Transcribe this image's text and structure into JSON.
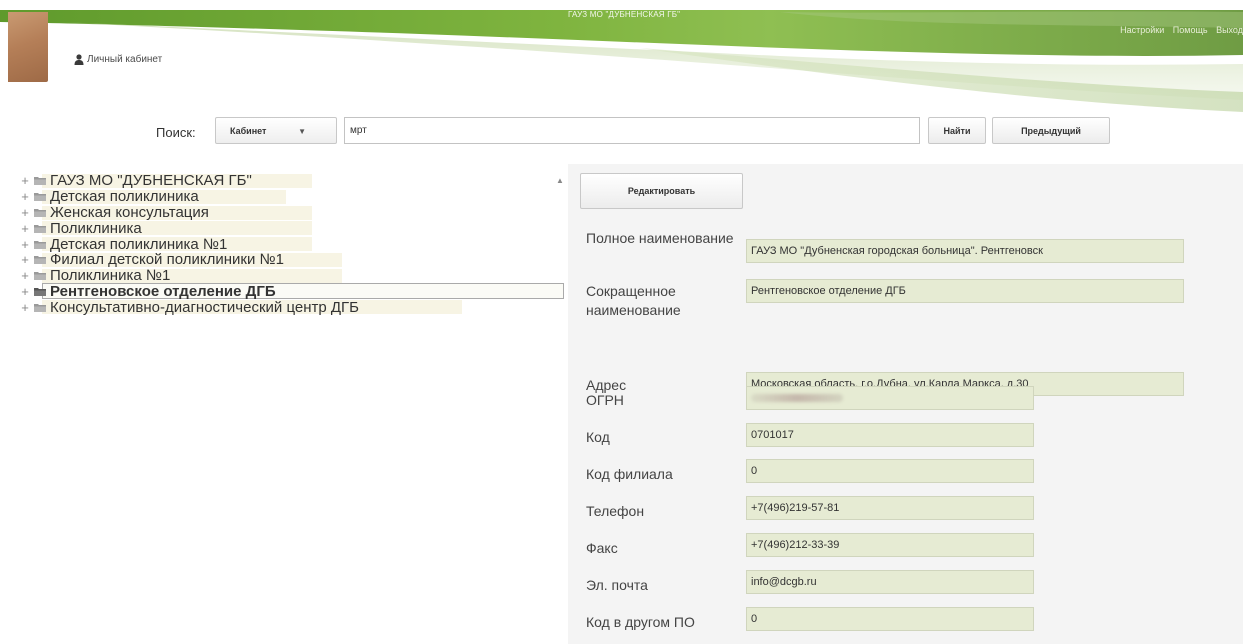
{
  "header": {
    "org_title": "ГАУЗ МО \"ДУБНЕНСКАЯ ГБ\"",
    "links": [
      "Настройки",
      "Помощь",
      "Выход"
    ],
    "cabinet_label": "Личный кабинет",
    "brand_green": "#7aab3c"
  },
  "search": {
    "label": "Поиск:",
    "type_value": "Кабинет",
    "query": "мрт",
    "find_label": "Найти",
    "prev_label": "Предыдущий"
  },
  "tree": {
    "items": [
      {
        "label": "ГАУЗ МО \"ДУБНЕНСКАЯ ГБ\"",
        "selected": false
      },
      {
        "label": "Детская поликлиника",
        "selected": false
      },
      {
        "label": "Женская консультация",
        "selected": false
      },
      {
        "label": "Поликлиника",
        "selected": false
      },
      {
        "label": "Детская поликлиника №1",
        "selected": false
      },
      {
        "label": "Филиал детской поликлиники №1",
        "selected": false
      },
      {
        "label": "Поликлиника №1",
        "selected": false
      },
      {
        "label": "Рентгеновское отделение ДГБ",
        "selected": true
      },
      {
        "label": "Консультативно-диагностический центр ДГБ",
        "selected": false
      }
    ]
  },
  "details": {
    "edit_label": "Редактировать",
    "fields": [
      {
        "label": "Полное наименование",
        "value": "ГАУЗ МО \"Дубненская городская больница\". Рентгеновск"
      },
      {
        "label": "Сокращенное наименование",
        "value": "Рентгеновское отделение ДГБ"
      },
      {
        "label": "Адрес",
        "value": "Московская область.  г.о.Дубна, ул.Карла Маркса, д.30"
      },
      {
        "label": "ОГРН",
        "value": ""
      },
      {
        "label": "Код",
        "value": "0701017"
      },
      {
        "label": "Код филиала",
        "value": "0"
      },
      {
        "label": "Телефон",
        "value": "+7(496)219-57-81"
      },
      {
        "label": "Факс",
        "value": "+7(496)212-33-39"
      },
      {
        "label": "Эл. почта",
        "value": "info@dcgb.ru"
      },
      {
        "label": "Код в другом ПО",
        "value": "0"
      }
    ]
  }
}
